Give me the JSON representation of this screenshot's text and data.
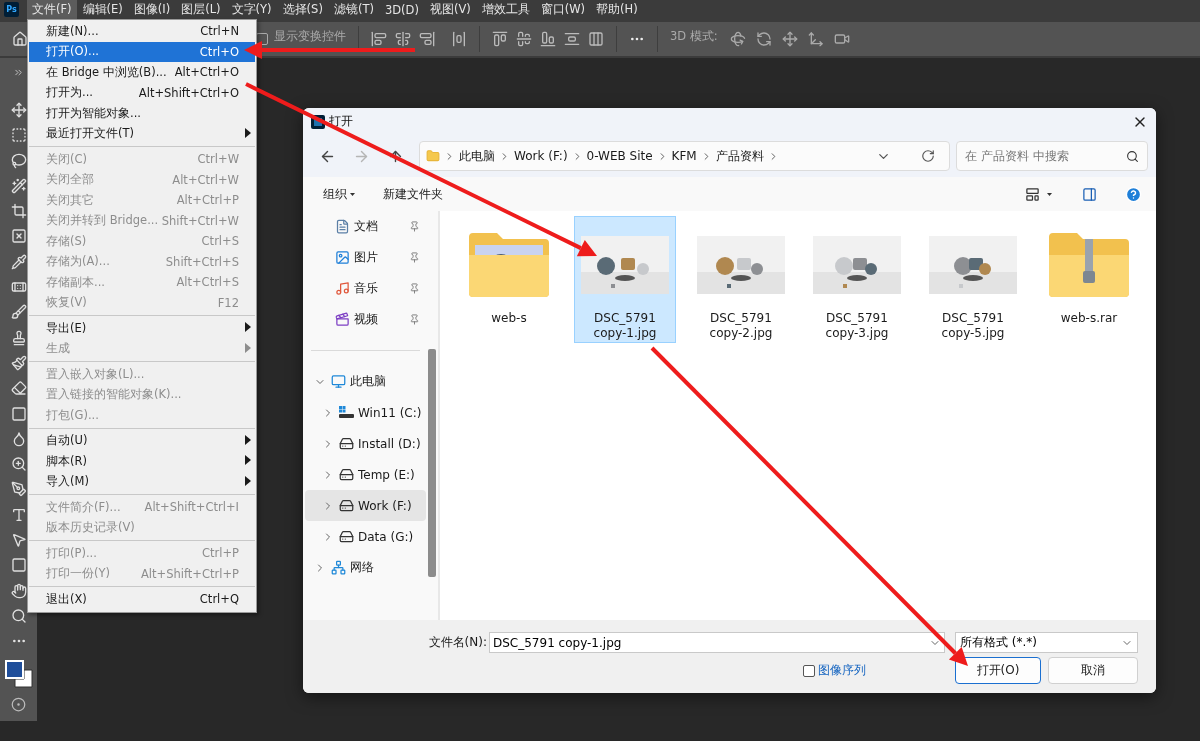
{
  "app": {
    "logo": "Ps"
  },
  "menu_bar": [
    {
      "label": "文件(F)",
      "selected": true
    },
    {
      "label": "编辑(E)",
      "selected": false
    },
    {
      "label": "图像(I)",
      "selected": false
    },
    {
      "label": "图层(L)",
      "selected": false
    },
    {
      "label": "文字(Y)",
      "selected": false
    },
    {
      "label": "选择(S)",
      "selected": false
    },
    {
      "label": "滤镜(T)",
      "selected": false
    },
    {
      "label": "3D(D)",
      "selected": false
    },
    {
      "label": "视图(V)",
      "selected": false
    },
    {
      "label": "增效工具",
      "selected": false
    },
    {
      "label": "窗口(W)",
      "selected": false
    },
    {
      "label": "帮助(H)",
      "selected": false
    }
  ],
  "options_bar": {
    "transform_controls": {
      "label": "显示变换控件",
      "checked": false
    },
    "mode_label": "3D 模式:"
  },
  "file_menu": [
    [
      {
        "label": "新建(N)...",
        "shortcut": "Ctrl+N",
        "submenu": false,
        "disabled": false,
        "selected": false
      },
      {
        "label": "打开(O)...",
        "shortcut": "Ctrl+O",
        "submenu": false,
        "disabled": false,
        "selected": true
      },
      {
        "label": "在 Bridge 中浏览(B)...",
        "shortcut": "Alt+Ctrl+O",
        "submenu": false,
        "disabled": false,
        "selected": false
      },
      {
        "label": "打开为...",
        "shortcut": "Alt+Shift+Ctrl+O",
        "submenu": false,
        "disabled": false,
        "selected": false
      },
      {
        "label": "打开为智能对象...",
        "submenu": false,
        "disabled": false,
        "selected": false
      },
      {
        "label": "最近打开文件(T)",
        "submenu": true,
        "disabled": false,
        "selected": false
      }
    ],
    [
      {
        "label": "关闭(C)",
        "shortcut": "Ctrl+W",
        "submenu": false,
        "disabled": true,
        "selected": false
      },
      {
        "label": "关闭全部",
        "shortcut": "Alt+Ctrl+W",
        "submenu": false,
        "disabled": true,
        "selected": false
      },
      {
        "label": "关闭其它",
        "shortcut": "Alt+Ctrl+P",
        "submenu": false,
        "disabled": true,
        "selected": false
      },
      {
        "label": "关闭并转到 Bridge...",
        "shortcut": "Shift+Ctrl+W",
        "submenu": false,
        "disabled": true,
        "selected": false
      },
      {
        "label": "存储(S)",
        "shortcut": "Ctrl+S",
        "submenu": false,
        "disabled": true,
        "selected": false
      },
      {
        "label": "存储为(A)...",
        "shortcut": "Shift+Ctrl+S",
        "submenu": false,
        "disabled": true,
        "selected": false
      },
      {
        "label": "存储副本...",
        "shortcut": "Alt+Ctrl+S",
        "submenu": false,
        "disabled": true,
        "selected": false
      },
      {
        "label": "恢复(V)",
        "shortcut": "F12",
        "submenu": false,
        "disabled": true,
        "selected": false
      }
    ],
    [
      {
        "label": "导出(E)",
        "submenu": true,
        "disabled": false,
        "selected": false
      },
      {
        "label": "生成",
        "submenu": true,
        "disabled": true,
        "selected": false
      }
    ],
    [
      {
        "label": "置入嵌入对象(L)...",
        "submenu": false,
        "disabled": true,
        "selected": false
      },
      {
        "label": "置入链接的智能对象(K)...",
        "submenu": false,
        "disabled": true,
        "selected": false
      },
      {
        "label": "打包(G)...",
        "submenu": false,
        "disabled": true,
        "selected": false
      }
    ],
    [
      {
        "label": "自动(U)",
        "submenu": true,
        "disabled": false,
        "selected": false
      },
      {
        "label": "脚本(R)",
        "submenu": true,
        "disabled": false,
        "selected": false
      },
      {
        "label": "导入(M)",
        "submenu": true,
        "disabled": false,
        "selected": false
      }
    ],
    [
      {
        "label": "文件简介(F)...",
        "shortcut": "Alt+Shift+Ctrl+I",
        "submenu": false,
        "disabled": true,
        "selected": false
      },
      {
        "label": "版本历史记录(V)",
        "submenu": false,
        "disabled": true,
        "selected": false
      }
    ],
    [
      {
        "label": "打印(P)...",
        "shortcut": "Ctrl+P",
        "submenu": false,
        "disabled": true,
        "selected": false
      },
      {
        "label": "打印一份(Y)",
        "shortcut": "Alt+Shift+Ctrl+P",
        "submenu": false,
        "disabled": true,
        "selected": false
      }
    ],
    [
      {
        "label": "退出(X)",
        "shortcut": "Ctrl+Q",
        "submenu": false,
        "disabled": false,
        "selected": false
      }
    ]
  ],
  "dialog": {
    "title": "打开",
    "nav_buttons": [
      {
        "kind": "back",
        "disabled": false
      },
      {
        "kind": "forward",
        "disabled": true
      },
      {
        "kind": "up",
        "disabled": false
      }
    ],
    "path": [
      "此电脑",
      "Work (F:)",
      "0-WEB Site",
      "KFM",
      "产品资料"
    ],
    "search": {
      "placeholder": "在 产品资料 中搜索"
    },
    "toolbar": {
      "organize": "组织",
      "new_folder": "新建文件夹"
    },
    "quick_access": [
      {
        "label": "文档",
        "kind": "documents",
        "pinned": true
      },
      {
        "label": "图片",
        "kind": "pictures",
        "pinned": true
      },
      {
        "label": "音乐",
        "kind": "music",
        "pinned": true
      },
      {
        "label": "视频",
        "kind": "videos",
        "pinned": true
      }
    ],
    "tree": [
      {
        "label": "此电脑",
        "kind": "computer",
        "expanded": true,
        "selected": false,
        "children": [
          {
            "label": "Win11 (C:)",
            "kind": "system-drive",
            "expanded": false,
            "selected": false
          },
          {
            "label": "Install (D:)",
            "kind": "drive",
            "expanded": false,
            "selected": false
          },
          {
            "label": "Temp (E:)",
            "kind": "drive",
            "expanded": false,
            "selected": false
          },
          {
            "label": "Work (F:)",
            "kind": "drive",
            "expanded": false,
            "selected": true
          },
          {
            "label": "Data (G:)",
            "kind": "drive",
            "expanded": false,
            "selected": false
          }
        ]
      },
      {
        "label": "网络",
        "kind": "network",
        "expanded": false,
        "selected": false
      }
    ],
    "files": [
      {
        "name": "web-s",
        "kind": "folder",
        "selected": false
      },
      {
        "name": "DSC_5791 copy-1.jpg",
        "selected": true
      },
      {
        "name": "DSC_5791 copy-2.jpg",
        "selected": false
      },
      {
        "name": "DSC_5791 copy-3.jpg",
        "selected": false
      },
      {
        "name": "DSC_5791 copy-5.jpg",
        "selected": false
      },
      {
        "name": "web-s.rar",
        "kind": "archive",
        "selected": false
      }
    ],
    "file_name": {
      "label": "文件名(N):",
      "value": "DSC_5791 copy-1.jpg"
    },
    "file_type": "所有格式 (*.*)",
    "image_sequence": {
      "label": "图像序列",
      "checked": false
    },
    "buttons": [
      {
        "label": "打开(O)",
        "kind": "primary"
      },
      {
        "label": "取消",
        "kind": "secondary"
      }
    ]
  }
}
